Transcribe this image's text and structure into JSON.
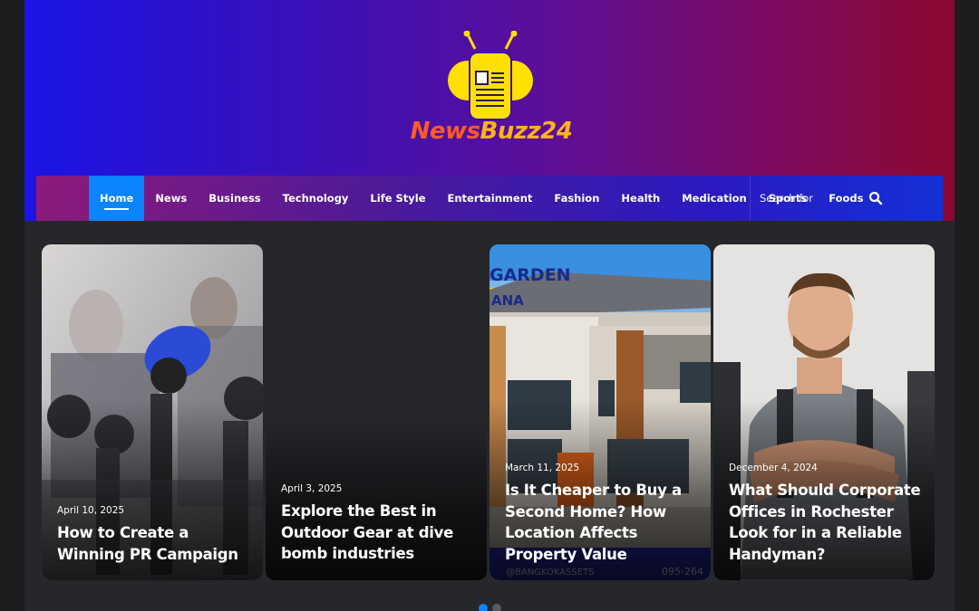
{
  "site": {
    "logo_part1": "News",
    "logo_part2": "Buzz24"
  },
  "nav": {
    "items": [
      {
        "label": "Home",
        "active": true
      },
      {
        "label": "News"
      },
      {
        "label": "Business"
      },
      {
        "label": "Technology"
      },
      {
        "label": "Life Style"
      },
      {
        "label": "Entertainment"
      },
      {
        "label": "Fashion"
      },
      {
        "label": "Health"
      },
      {
        "label": "Medication"
      },
      {
        "label": "Sports"
      },
      {
        "label": "Foods"
      }
    ],
    "search_placeholder": "Search for"
  },
  "slider": {
    "cards": [
      {
        "date": "April 10, 2025",
        "title": "How to Create a Winning PR Campaign",
        "image": "press-microphones-photo"
      },
      {
        "date": "April 3, 2025",
        "title": "Explore the Best in Outdoor Gear at dive bomb industries",
        "image": "none"
      },
      {
        "date": "March 11, 2025",
        "title": "Is It Cheaper to Buy a Second Home? How Location Affects Property Value",
        "image": "townhouse-photo",
        "image_text_top": "GARDEN",
        "image_text_badge": "ANA",
        "image_text_bottom_left": "@BANGKOKASSETS",
        "image_text_bottom_right": "095-264"
      },
      {
        "date": "December 4, 2024",
        "title": "What Should Corporate Offices in Rochester Look for in a Reliable Handyman?",
        "image": "handyman-portrait-photo"
      }
    ],
    "active_page": 1,
    "page_count": 2
  },
  "colors": {
    "accent": "#0a84ff",
    "header_left": "#1a14e6",
    "header_right": "#8c0830"
  }
}
